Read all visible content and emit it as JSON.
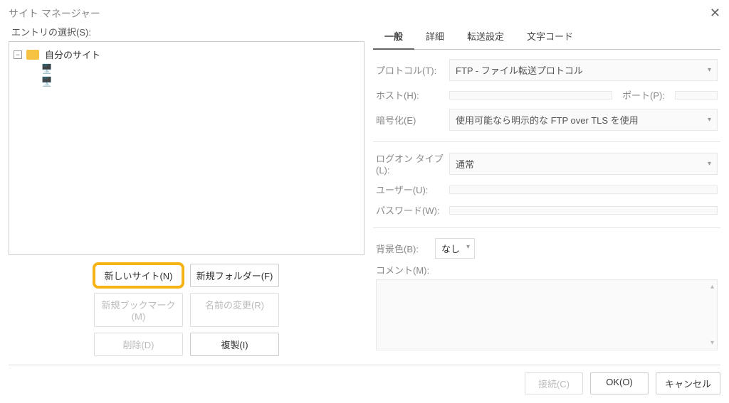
{
  "title": "サイト マネージャー",
  "entry_label": "エントリの選択(S):",
  "tree": {
    "root": "自分のサイト"
  },
  "buttons": {
    "new_site": "新しいサイト(N)",
    "new_folder": "新規フォルダー(F)",
    "new_bookmark": "新規ブックマーク(M)",
    "rename": "名前の変更(R)",
    "delete": "削除(D)",
    "duplicate": "複製(I)"
  },
  "tabs": {
    "general": "一般",
    "detail": "詳細",
    "transfer": "転送設定",
    "charset": "文字コード"
  },
  "form": {
    "protocol_label": "プロトコル(T):",
    "protocol_value": "FTP - ファイル転送プロトコル",
    "host_label": "ホスト(H):",
    "port_label": "ポート(P):",
    "encryption_label": "暗号化(E)",
    "encryption_value": "使用可能なら明示的な FTP over TLS を使用",
    "logon_label": "ログオン タイプ(L):",
    "logon_value": "通常",
    "user_label": "ユーザー(U):",
    "password_label": "パスワード(W):",
    "bgcolor_label": "背景色(B):",
    "bgcolor_value": "なし",
    "comment_label": "コメント(M):"
  },
  "footer": {
    "connect": "接続(C)",
    "ok": "OK(O)",
    "cancel": "キャンセル"
  }
}
